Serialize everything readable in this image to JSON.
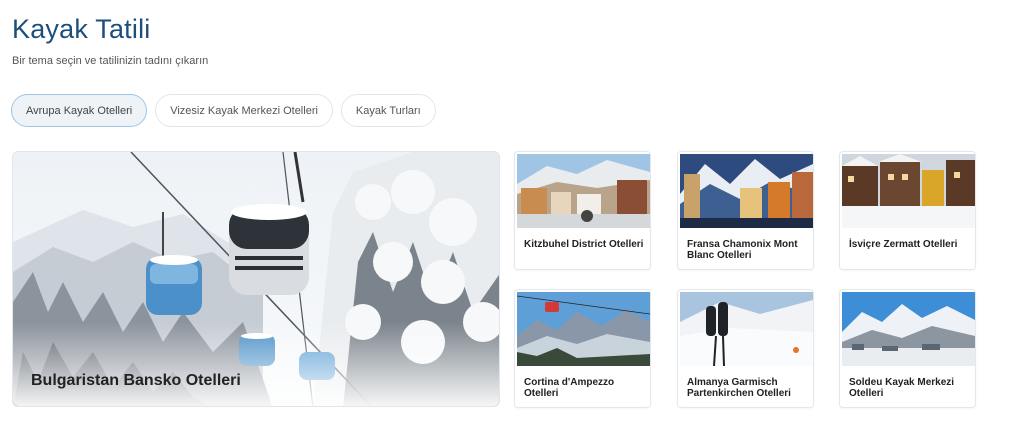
{
  "page": {
    "title": "Kayak Tatili",
    "subtitle": "Bir tema seçin ve tatilinizin tadını çıkarın"
  },
  "tabs": [
    {
      "label": "Avrupa Kayak Otelleri",
      "active": true
    },
    {
      "label": "Vizesiz Kayak Merkezi Otelleri",
      "active": false
    },
    {
      "label": "Kayak Turları",
      "active": false
    }
  ],
  "featured": {
    "label": "Bulgaristan Bansko Otelleri"
  },
  "cards": [
    {
      "label": "Kitzbuhel District Otelleri"
    },
    {
      "label": "Fransa Chamonix Mont Blanc Otelleri"
    },
    {
      "label": "İsviçre Zermatt Otelleri"
    },
    {
      "label": "Cortina d'Ampezzo Otelleri"
    },
    {
      "label": "Almanya Garmisch Partenkirchen Otelleri"
    },
    {
      "label": "Soldeu Kayak Merkezi Otelleri"
    }
  ],
  "colors": {
    "title": "#1c4f7c",
    "active_tab_border": "#9fc6e6"
  }
}
